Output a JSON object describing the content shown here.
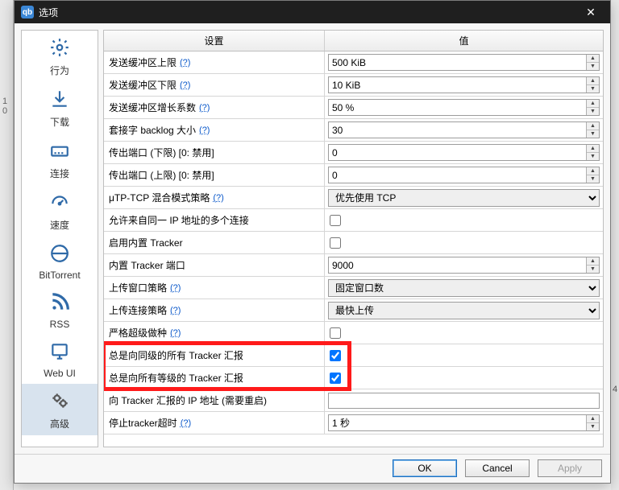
{
  "window_title": "选项",
  "close_glyph": "✕",
  "sidebar": {
    "items": [
      {
        "id": "behavior",
        "label": "行为"
      },
      {
        "id": "download",
        "label": "下载"
      },
      {
        "id": "connection",
        "label": "连接"
      },
      {
        "id": "speed",
        "label": "速度"
      },
      {
        "id": "bittorrent",
        "label": "BitTorrent"
      },
      {
        "id": "rss",
        "label": "RSS"
      },
      {
        "id": "webui",
        "label": "Web UI"
      },
      {
        "id": "advanced",
        "label": "高级"
      }
    ],
    "active_index": 7
  },
  "grid": {
    "headers": {
      "setting": "设置",
      "value": "值"
    },
    "help_text": "(?)",
    "rows": [
      {
        "key": "发送缓冲区上限",
        "help": true,
        "type": "spin",
        "value": "500 KiB"
      },
      {
        "key": "发送缓冲区下限",
        "help": true,
        "type": "spin",
        "value": "10 KiB"
      },
      {
        "key": "发送缓冲区增长系数",
        "help": true,
        "type": "spin",
        "value": "50 %"
      },
      {
        "key": "套接字 backlog 大小",
        "help": true,
        "type": "spin",
        "value": "30"
      },
      {
        "key": "传出端口 (下限) [0: 禁用]",
        "help": false,
        "type": "spin",
        "value": "0"
      },
      {
        "key": "传出端口 (上限) [0: 禁用]",
        "help": false,
        "type": "spin",
        "value": "0"
      },
      {
        "key": "μTP-TCP 混合模式策略",
        "help": true,
        "type": "combo",
        "value": "优先使用 TCP"
      },
      {
        "key": "允许来自同一 IP 地址的多个连接",
        "help": false,
        "type": "check",
        "value": false
      },
      {
        "key": "启用内置 Tracker",
        "help": false,
        "type": "check",
        "value": false
      },
      {
        "key": "内置 Tracker 端口",
        "help": false,
        "type": "spin",
        "value": "9000"
      },
      {
        "key": "上传窗口策略",
        "help": true,
        "type": "combo",
        "value": "固定窗口数"
      },
      {
        "key": "上传连接策略",
        "help": true,
        "type": "combo",
        "value": "最快上传"
      },
      {
        "key": "严格超级做种",
        "help": true,
        "type": "check",
        "value": false
      },
      {
        "key": "总是向同级的所有 Tracker 汇报",
        "help": false,
        "type": "check",
        "value": true
      },
      {
        "key": "总是向所有等级的 Tracker 汇报",
        "help": false,
        "type": "check",
        "value": true
      },
      {
        "key": "向 Tracker 汇报的 IP 地址 (需要重启)",
        "help": false,
        "type": "text",
        "value": ""
      },
      {
        "key": "停止tracker超时",
        "help": true,
        "type": "spin",
        "value": "1 秒"
      }
    ]
  },
  "highlight": {
    "row_start": 13,
    "row_end": 14
  },
  "buttons": {
    "ok": "OK",
    "cancel": "Cancel",
    "apply": "Apply"
  },
  "left_numbers": [
    "1",
    "0"
  ],
  "right_number": "4",
  "icon_color": "#2f6aa8"
}
